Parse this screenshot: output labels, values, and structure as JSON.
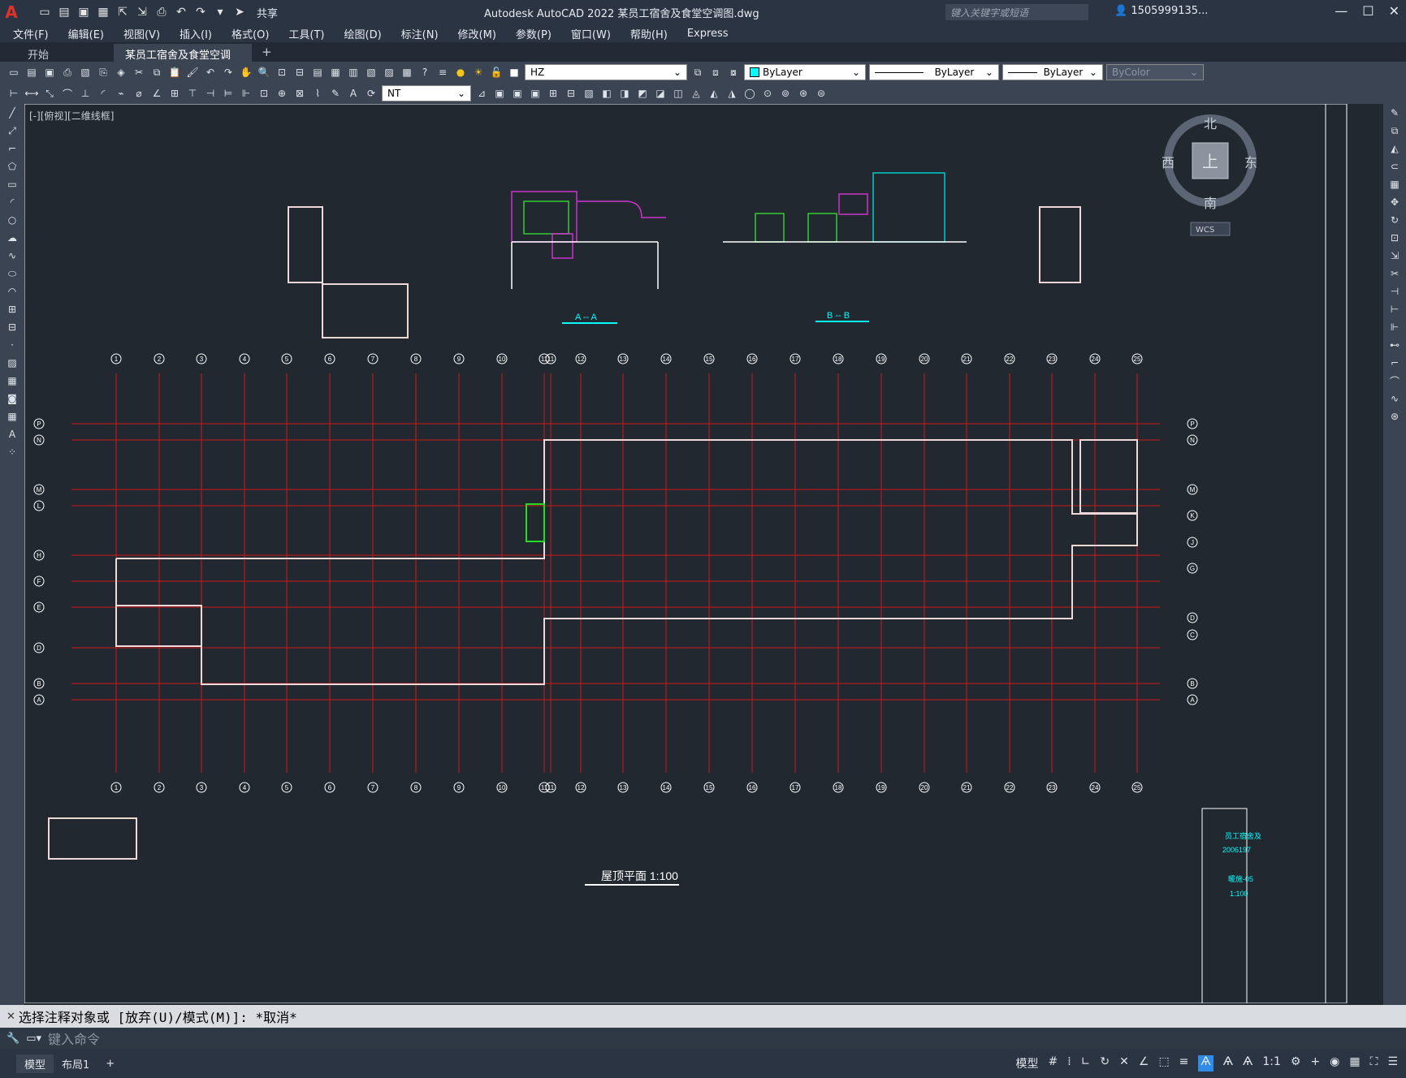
{
  "app": {
    "logo": "A",
    "title": "Autodesk AutoCAD 2022    某员工宿舍及食堂空调图.dwg",
    "share_label": "共享",
    "search_placeholder": "键入关键字或短语",
    "user": "1505999135...",
    "win_min": "—",
    "win_max": "☐",
    "win_close": "✕"
  },
  "menu": [
    "文件(F)",
    "编辑(E)",
    "视图(V)",
    "插入(I)",
    "格式(O)",
    "工具(T)",
    "绘图(D)",
    "标注(N)",
    "修改(M)",
    "参数(P)",
    "窗口(W)",
    "帮助(H)",
    "Express"
  ],
  "tabs": {
    "start": "开始",
    "active": "某员工宿舍及食堂空调图*",
    "close": "✕",
    "add": "+"
  },
  "toolbar": {
    "layer": "HZ",
    "color": "ByLayer",
    "linetype": "ByLayer",
    "lineweight": "ByLayer",
    "plotstyle": "ByColor",
    "textstyle": "NT"
  },
  "viewport": {
    "label": "[-][俯视][二维线框]",
    "viewcube": {
      "north": "北",
      "south": "南",
      "east": "东",
      "west": "西",
      "top": "上",
      "wcs": "WCS"
    }
  },
  "drawing": {
    "plan_title": "屋顶平面 1:100",
    "section_a": "A -- A",
    "section_b": "B -- B",
    "axes_top": [
      "1",
      "2",
      "3",
      "4",
      "5",
      "6",
      "7",
      "8",
      "9",
      "10",
      "11",
      "11",
      "12",
      "13",
      "14",
      "15",
      "16",
      "17",
      "18",
      "19",
      "20",
      "21",
      "22",
      "23",
      "24",
      "25"
    ],
    "axes_left": [
      "P",
      "N",
      "M",
      "L",
      "H",
      "F",
      "E",
      "D",
      "B",
      "A"
    ],
    "axes_right": [
      "P",
      "N",
      "M",
      "K",
      "J",
      "G",
      "D",
      "C",
      "B",
      "A"
    ],
    "title_block": [
      "员工宿舍及",
      "2006197",
      "暖施-05",
      "1:100"
    ]
  },
  "command": {
    "history": "选择注释对象或 [放弃(U)/模式(M)]: *取消*",
    "placeholder": "键入命令"
  },
  "status": {
    "tab_model": "模型",
    "tab_layout1": "布局1",
    "add": "+",
    "model_btn": "模型",
    "scale": "1:1"
  }
}
